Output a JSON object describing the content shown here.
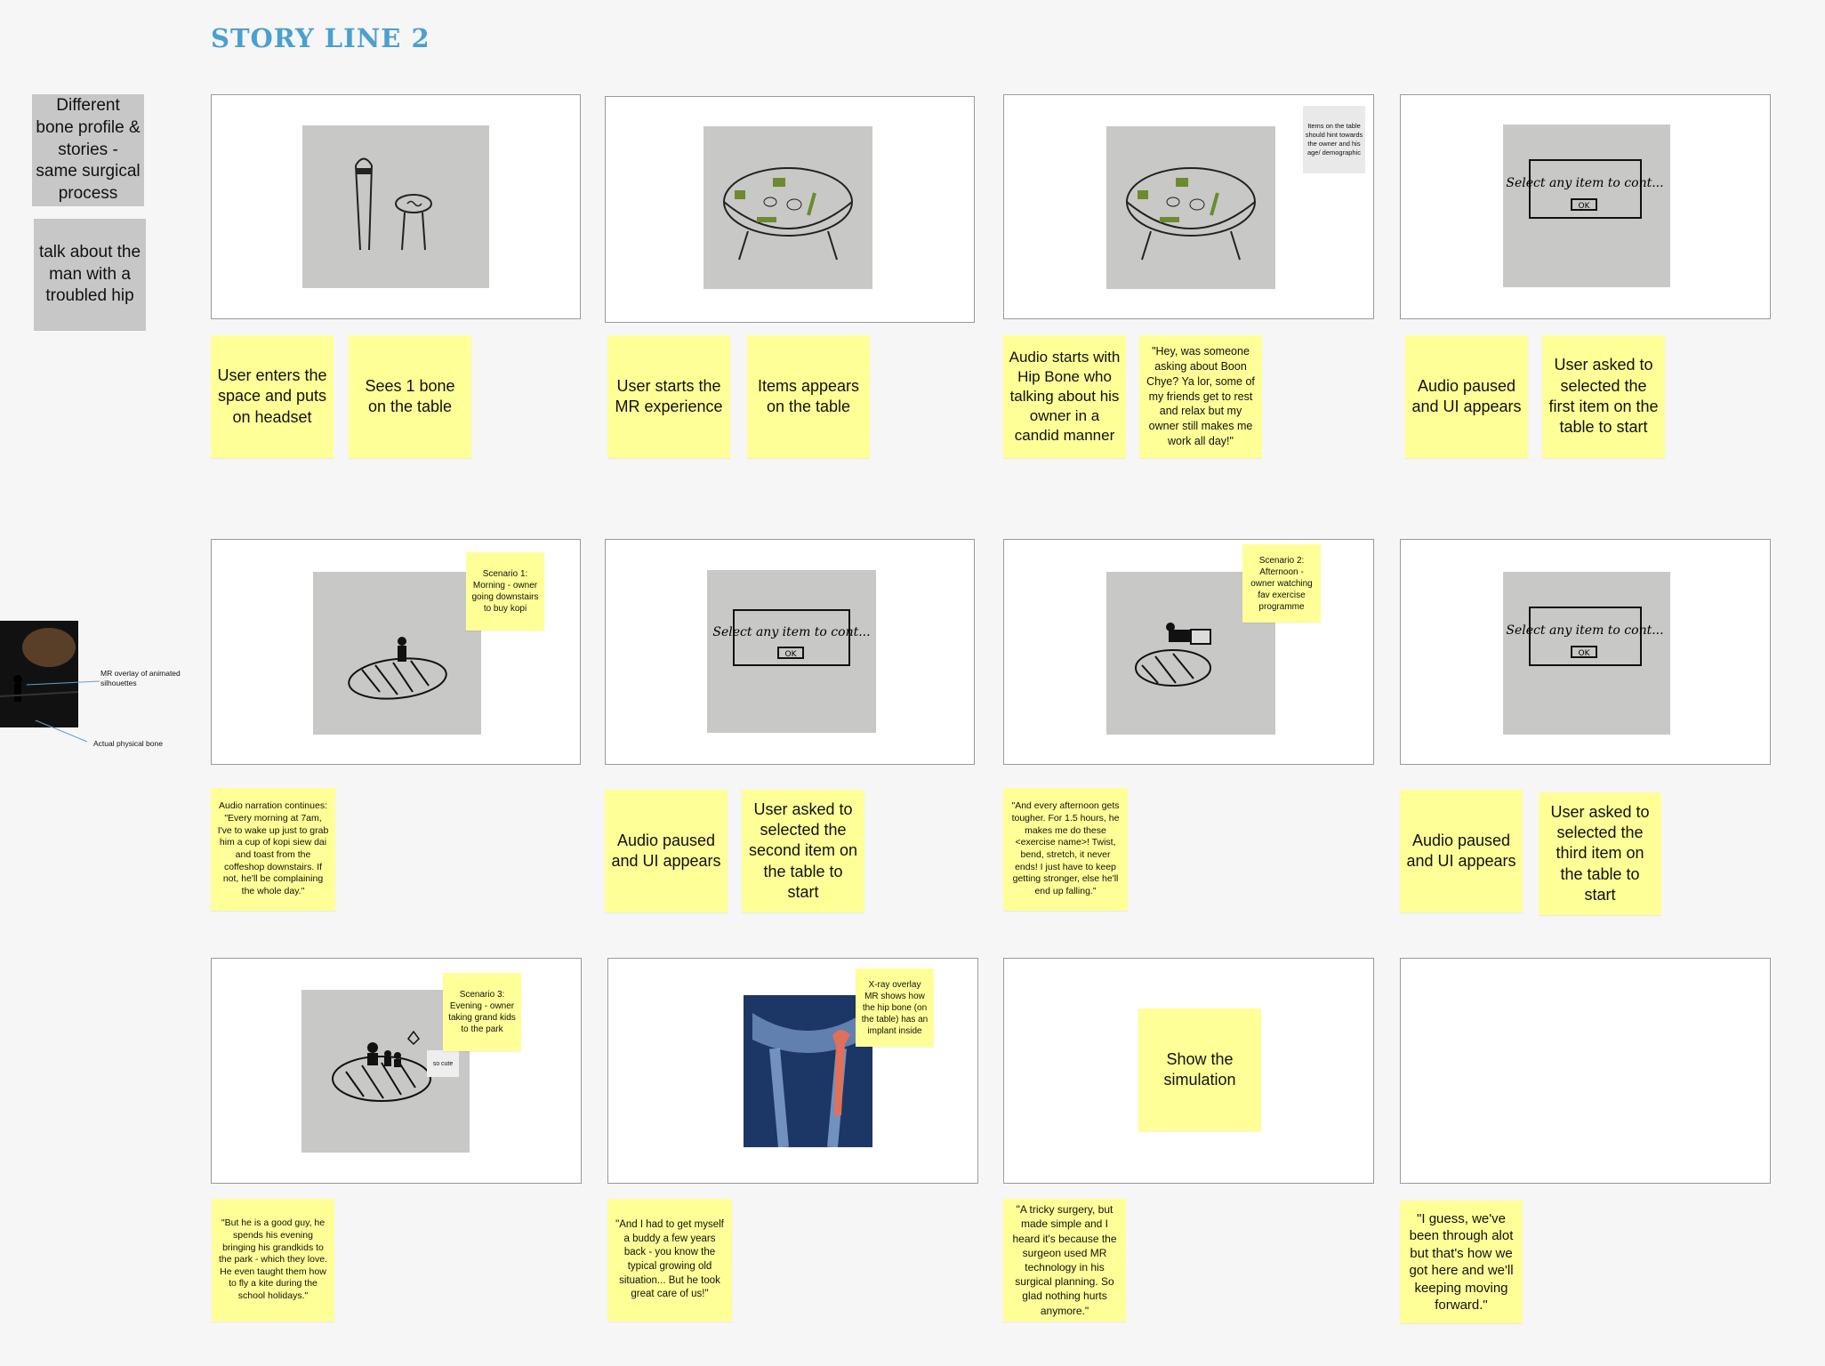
{
  "page": {
    "title": "STORY LINE 2"
  },
  "side_notes": {
    "note1": "Different bone profile & stories - same surgical process",
    "note2": "talk about the man with a troubled hip",
    "mr_overlay": "MR overlay of animated silhouettes",
    "physical_bone": "Actual physical bone"
  },
  "row1": {
    "frame1": {
      "sticky_a": "User enters the space and puts on headset",
      "sticky_b": "Sees 1 bone on the table"
    },
    "frame2": {
      "sticky_a": "User starts the MR experience",
      "sticky_b": "Items appears on the table"
    },
    "frame3": {
      "note": "Items on the table should hint towards the owner and his age/ demographic",
      "sticky_a": "Audio starts with Hip Bone who talking about his owner in a candid manner",
      "sticky_b": "\"Hey, was someone asking about Boon Chye? Ya lor, some of my friends get to rest and relax but my owner still makes me work all day!\""
    },
    "frame4": {
      "sketch_text": "Select any item to cont...",
      "sketch_button": "OK",
      "sticky_a": "Audio paused and UI appears",
      "sticky_b": "User asked to selected the first item on the table to start"
    }
  },
  "row2": {
    "frame1": {
      "scenario": "Scenario 1: Morning - owner going downstairs to buy kopi",
      "sticky_a": "Audio narration continues: \"Every morning at 7am, I've to wake up just to grab him a cup of kopi siew dai and toast from the coffeshop downstairs. If not, he'll be complaining the whole day.\""
    },
    "frame2": {
      "sketch_text": "Select any item to cont...",
      "sketch_button": "OK",
      "sticky_a": "Audio paused and UI appears",
      "sticky_b": "User asked to selected the second item on the table to start"
    },
    "frame3": {
      "scenario": "Scenario 2: Afternoon - owner watching fav exercise programme",
      "sticky_a": "\"And every afternoon gets tougher. For 1.5 hours, he makes me do these <exercise name>! Twist, bend, stretch, it never ends! I just have to keep getting stronger, else he'll end up falling.\""
    },
    "frame4": {
      "sketch_text": "Select any item to cont...",
      "sketch_button": "OK",
      "sticky_a": "Audio paused and UI appears",
      "sticky_b": "User asked to selected the third item on the table to start"
    }
  },
  "row3": {
    "frame1": {
      "scenario": "Scenario 3: Evening - owner taking grand kids to the park",
      "tag": "so cute",
      "sticky_a": "\"But he is a good guy, he spends his evening bringing his grandkids to the park - which they love. He even taught them how to fly a kite during the school holidays.\""
    },
    "frame2": {
      "scenario": "X-ray overlay MR shows how the hip bone (on the table) has an implant inside",
      "sticky_a": "\"And I had to get myself a buddy a few years back - you know the typical growing old situation... But he took great care of us!\""
    },
    "frame3": {
      "sticky_inside": "Show the simulation",
      "sticky_a": "\"A tricky surgery, but made simple and I heard it's because the surgeon used MR technology in his surgical planning. So glad nothing hurts anymore.\""
    },
    "frame4": {
      "sticky_a": "\"I guess, we've been through alot but that's how we got here and we'll keeping moving forward.\""
    }
  },
  "colors": {
    "title": "#4aa0cf",
    "sticky": "#ffff98",
    "grey_note": "#c7c7c7",
    "implant": "#e0705a"
  }
}
